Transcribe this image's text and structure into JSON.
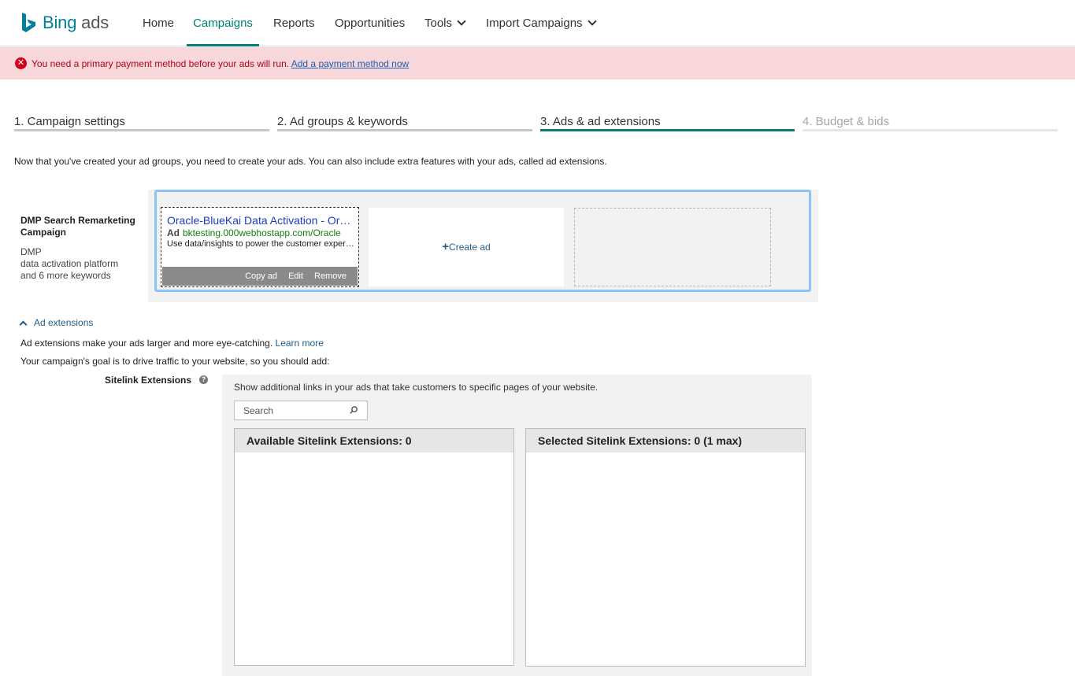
{
  "app": {
    "logo_text": "Bing",
    "logo_suffix": "ads",
    "brand_color": "#00809d"
  },
  "nav": {
    "home": "Home",
    "campaigns": "Campaigns",
    "reports": "Reports",
    "opportunities": "Opportunities",
    "tools": "Tools",
    "import_campaigns": "Import Campaigns"
  },
  "alert": {
    "message": "You need a primary payment method before your ads will run.",
    "link": "Add a payment method now",
    "color": "#d0021b"
  },
  "steps": [
    {
      "label": "1. Campaign settings",
      "state": "done"
    },
    {
      "label": "2. Ad groups & keywords",
      "state": "done"
    },
    {
      "label": "3. Ads & ad extensions",
      "state": "active"
    },
    {
      "label": "4. Budget & bids",
      "state": "disabled"
    }
  ],
  "intro": "Now that you've created your ad groups, you need to create your ads. You can also include extra features with your ads, called ad extensions.",
  "ad_group": {
    "name": "DMP Search Remarketing Campaign",
    "keyword_1": "DMP",
    "keyword_2": "data activation platform",
    "more_keywords": "and 6 more keywords"
  },
  "ad": {
    "title": "Oracle-BlueKai Data Activation - Oracle",
    "badge": "Ad",
    "display_url": "bktesting.000webhostapp.com/Oracle",
    "description": "Use data/insights to power the customer experience",
    "copy_label": "Copy ad",
    "edit_label": "Edit",
    "remove_label": "Remove"
  },
  "create_ad": {
    "icon": "plus-icon",
    "label": "Create ad"
  },
  "extensions": {
    "toggle_label": "Ad extensions",
    "line1": "Ad extensions make your ads larger and more eye-catching.",
    "learn_more": "Learn more",
    "line2": "Your campaign's goal is to drive traffic to your website, so you should add:"
  },
  "sitelink": {
    "label": "Sitelink Extensions",
    "help_icon": "?",
    "description": "Show additional links in your ads that take customers to specific pages of your website.",
    "search_placeholder": "Search",
    "available_header": "Available Sitelink Extensions:  0",
    "selected_header": "Selected Sitelink Extensions:  0 (1 max)"
  }
}
